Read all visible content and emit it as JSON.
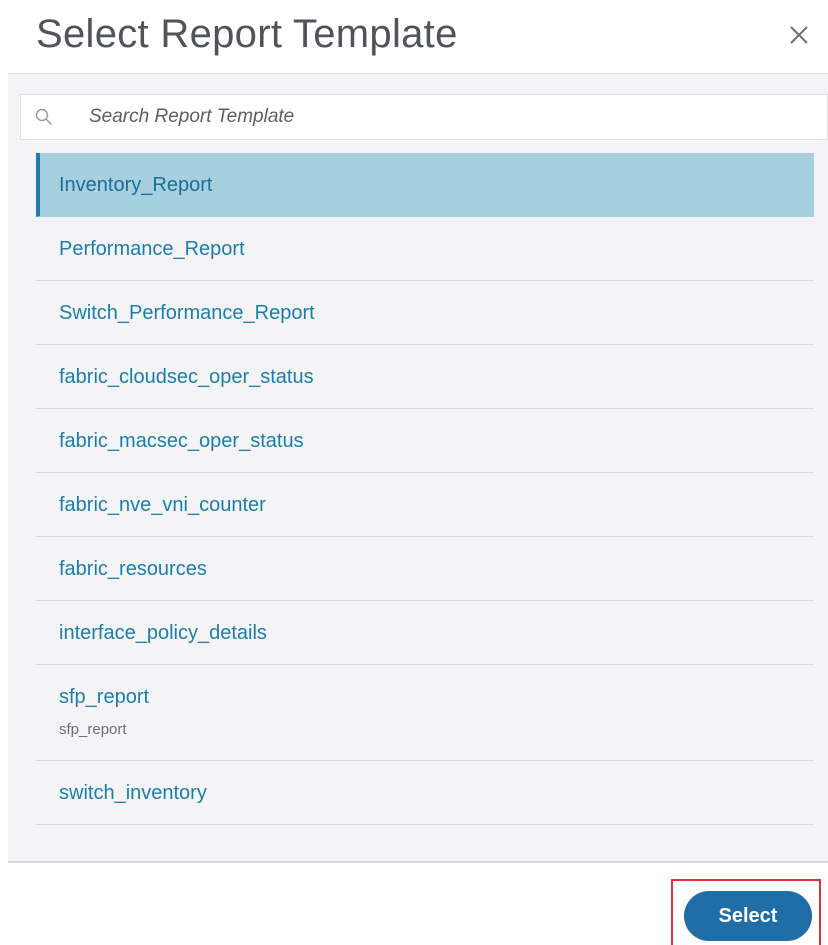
{
  "dialog": {
    "title": "Select Report Template",
    "close_icon": "close-icon"
  },
  "search": {
    "placeholder": "Search Report Template",
    "value": "",
    "icon": "search-icon"
  },
  "templates": [
    {
      "label": "Inventory_Report",
      "description": "",
      "selected": true
    },
    {
      "label": "Performance_Report",
      "description": "",
      "selected": false
    },
    {
      "label": "Switch_Performance_Report",
      "description": "",
      "selected": false
    },
    {
      "label": "fabric_cloudsec_oper_status",
      "description": "",
      "selected": false
    },
    {
      "label": "fabric_macsec_oper_status",
      "description": "",
      "selected": false
    },
    {
      "label": "fabric_nve_vni_counter",
      "description": "",
      "selected": false
    },
    {
      "label": "fabric_resources",
      "description": "",
      "selected": false
    },
    {
      "label": "interface_policy_details",
      "description": "",
      "selected": false
    },
    {
      "label": "sfp_report",
      "description": "sfp_report",
      "selected": false
    },
    {
      "label": "switch_inventory",
      "description": "",
      "selected": false
    }
  ],
  "footer": {
    "select_label": "Select"
  },
  "colors": {
    "accent": "#1f6ea8",
    "link": "#1c7ea8",
    "selected_bg": "#a6cfe0",
    "selected_border": "#1c7fae",
    "highlight": "#e0323a"
  }
}
